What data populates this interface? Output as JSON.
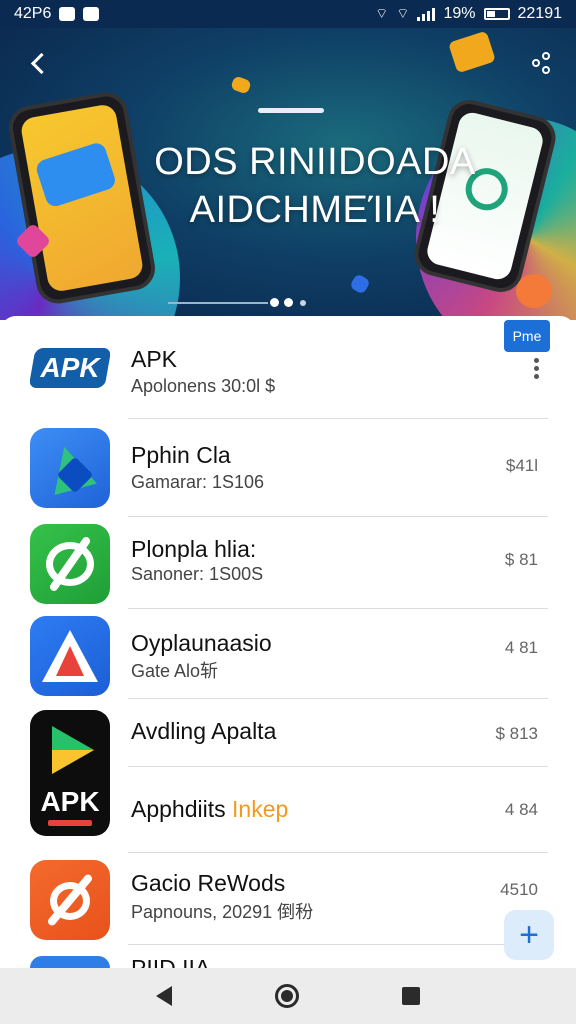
{
  "status_bar": {
    "time": "42P6",
    "battery": "19%",
    "clock_right": "22191"
  },
  "banner": {
    "title_line1": "ODS RINIIDOADA",
    "title_line2": "AIDCHMEΊIA !"
  },
  "badge": {
    "label": "Pme"
  },
  "apps": [
    {
      "title": "APK",
      "subtitle": "Apolonens 30:0l $",
      "price": ""
    },
    {
      "title": "Pphin Cla",
      "subtitle": "Gamarar: 1S106",
      "price": "$41l"
    },
    {
      "title": "Plonpla hlia:",
      "subtitle": "Sanoner: 1S00S",
      "price": "$ 81"
    },
    {
      "title": "Oyplaunaasio",
      "subtitle": "Gate Alo斩",
      "price": "4 81"
    },
    {
      "title": "Avdling Apalta",
      "subtitle": "",
      "price": "$ 813"
    },
    {
      "title": "Apphdiits",
      "subtitle_accent": "Inkep",
      "price": "4 84"
    },
    {
      "title": "Gacio ReWods",
      "subtitle": "Papnouns, 20291 倒秎",
      "price": "4510"
    },
    {
      "title": "PIID IIA",
      "subtitle": "",
      "price": ""
    }
  ],
  "icons": {
    "apk_text": "APK",
    "black_apk_text": "APK"
  },
  "fab": {
    "label": "+"
  },
  "colors": {
    "accent": "#1b6fd6",
    "accent_orange": "#f39a1e",
    "status_bar_bg": "#0b2a52"
  }
}
